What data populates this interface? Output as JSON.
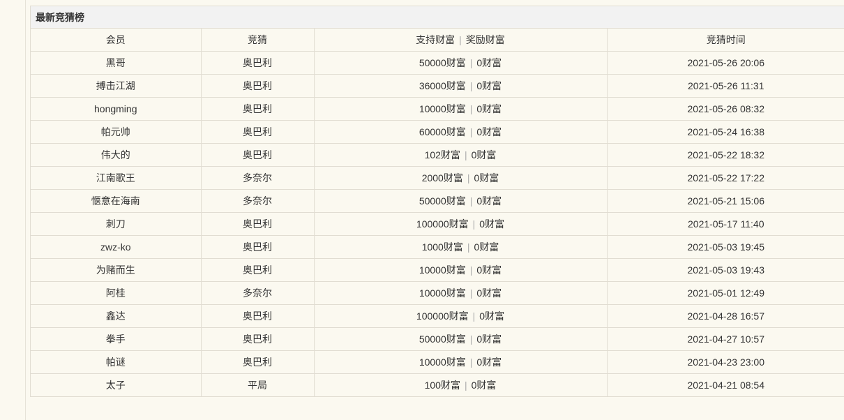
{
  "panel": {
    "title": "最新竞猜榜"
  },
  "table": {
    "headers": {
      "member": "会员",
      "guess": "竞猜",
      "support": "支持财富",
      "separator": "|",
      "reward": "奖励财富",
      "time": "竞猜时间"
    },
    "rows": [
      {
        "member": "黑哥",
        "guess": "奥巴利",
        "support": "50000财富",
        "reward": "0财富",
        "time": "2021-05-26 20:06"
      },
      {
        "member": "搏击江湖",
        "guess": "奥巴利",
        "support": "36000财富",
        "reward": "0财富",
        "time": "2021-05-26 11:31"
      },
      {
        "member": "hongming",
        "guess": "奥巴利",
        "support": "10000财富",
        "reward": "0财富",
        "time": "2021-05-26 08:32"
      },
      {
        "member": "帕元帅",
        "guess": "奥巴利",
        "support": "60000财富",
        "reward": "0财富",
        "time": "2021-05-24 16:38"
      },
      {
        "member": "伟大的",
        "guess": "奥巴利",
        "support": "102财富",
        "reward": "0财富",
        "time": "2021-05-22 18:32"
      },
      {
        "member": "江南歌王",
        "guess": "多奈尔",
        "support": "2000财富",
        "reward": "0财富",
        "time": "2021-05-22 17:22"
      },
      {
        "member": "惬意在海南",
        "guess": "多奈尔",
        "support": "50000财富",
        "reward": "0财富",
        "time": "2021-05-21 15:06"
      },
      {
        "member": "刺刀",
        "guess": "奥巴利",
        "support": "100000财富",
        "reward": "0财富",
        "time": "2021-05-17 11:40"
      },
      {
        "member": "zwz-ko",
        "guess": "奥巴利",
        "support": "1000财富",
        "reward": "0财富",
        "time": "2021-05-03 19:45"
      },
      {
        "member": "为赌而生",
        "guess": "奥巴利",
        "support": "10000财富",
        "reward": "0财富",
        "time": "2021-05-03 19:43"
      },
      {
        "member": "阿桂",
        "guess": "多奈尔",
        "support": "10000财富",
        "reward": "0财富",
        "time": "2021-05-01 12:49"
      },
      {
        "member": "鑫达",
        "guess": "奥巴利",
        "support": "100000财富",
        "reward": "0财富",
        "time": "2021-04-28 16:57"
      },
      {
        "member": "拳手",
        "guess": "奥巴利",
        "support": "50000财富",
        "reward": "0财富",
        "time": "2021-04-27 10:57"
      },
      {
        "member": "帕谜",
        "guess": "奥巴利",
        "support": "10000财富",
        "reward": "0财富",
        "time": "2021-04-23 23:00"
      },
      {
        "member": "太子",
        "guess": "平局",
        "support": "100财富",
        "reward": "0财富",
        "time": "2021-04-21 08:54"
      }
    ]
  }
}
